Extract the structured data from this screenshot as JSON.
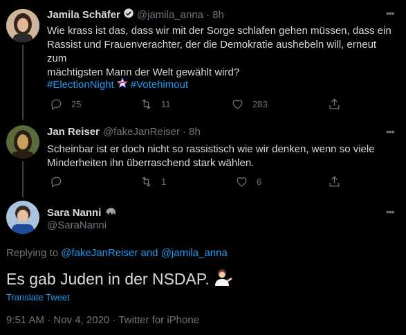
{
  "colors": {
    "background": "#000000",
    "text": "#d9d9d9",
    "muted": "#6e767d",
    "link": "#1d9bf0",
    "verified": "#d9d9d9"
  },
  "tweet1": {
    "name": "Jamila Schäfer",
    "handle": "@jamila_anna",
    "time": "· 8h",
    "text_line1": "Wie krass ist das, dass wir mit der Sorge schlafen gehen müssen, dass ein",
    "text_line2": "Rassist und Frauenverachter, der die Demokratie aushebeln will, erneut zum",
    "text_line3": "mächtigsten Mann der Welt gewählt wird?",
    "hashtag1": "#ElectionNight",
    "hashtag2": "#Votehimout",
    "replies": "25",
    "retweets": "11",
    "likes": "283",
    "icons": [
      "comment-icon",
      "retweet-icon",
      "like-icon",
      "share-icon",
      "verified-icon",
      "election-star-icon"
    ]
  },
  "tweet2": {
    "name": "Jan Reiser",
    "handle": "@fakeJanReiser",
    "time": "· 8h",
    "text_line1": "Scheinbar ist er doch nicht so rassistisch wie wir denken, wenn so viele",
    "text_line2": "Minderheiten ihn überraschend stark wählen.",
    "replies": "",
    "retweets": "1",
    "likes": "6"
  },
  "main_tweet": {
    "name": "Sara Nanni",
    "name_icon": "elephant-emoji",
    "handle": "@SaraNanni",
    "replying_prefix": "Replying to",
    "replying_user1": "@fakeJanReiser",
    "replying_and": "and",
    "replying_user2": "@jamila_anna",
    "text": "Es gab Juden in der NSDAP.",
    "text_emoji": "woman-tipping-hand-emoji",
    "translate": "Translate Tweet",
    "meta": "9:51 AM · Nov 4, 2020 · Twitter for iPhone"
  }
}
